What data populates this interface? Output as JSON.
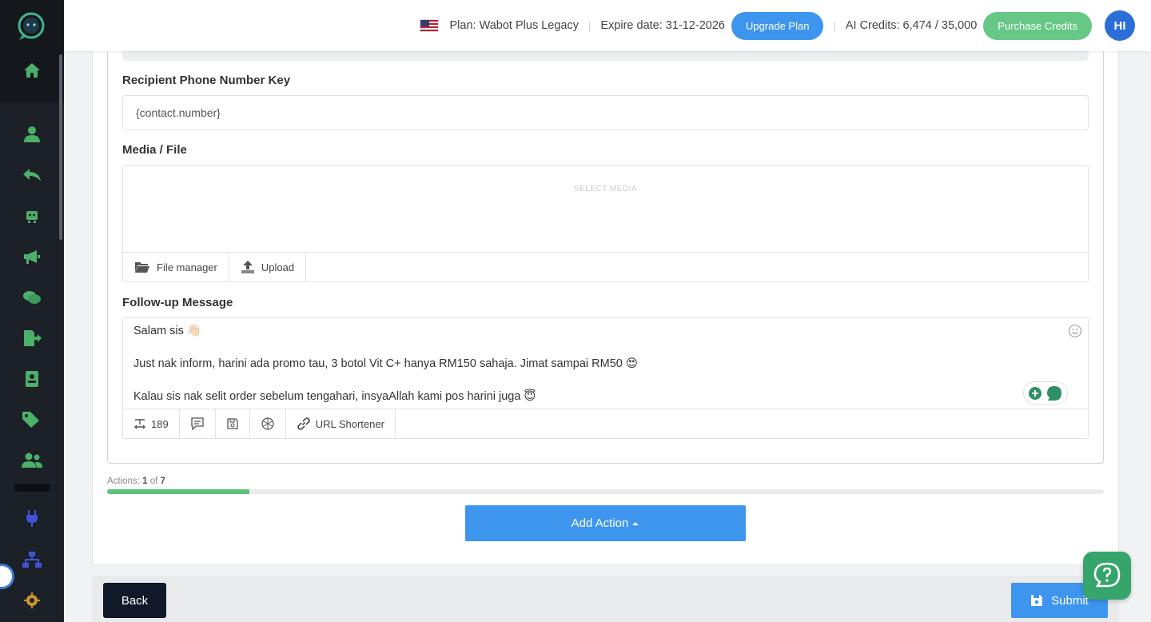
{
  "header": {
    "plan_label": "Plan: Wabot Plus Legacy",
    "expire_label": "Expire date: 31-12-2026",
    "upgrade_button": "Upgrade Plan",
    "credits_label": "AI Credits: 6,474 / 35,000",
    "purchase_button": "Purchase Credits",
    "avatar_initials": "HI",
    "separator": "|"
  },
  "form": {
    "recipient_label": "Recipient Phone Number Key",
    "recipient_value": "{contact.number}",
    "media_label": "Media / File",
    "media_placeholder": "SELECT MEDIA",
    "file_manager_button": "File manager",
    "upload_button": "Upload",
    "followup_label": "Follow-up Message",
    "message_lines": [
      "Salam sis 👋🏻",
      "",
      "Just nak inform, harini ada promo tau, 3 botol Vit C+ hanya RM150 sahaja. Jimat sampai RM50 😍",
      "",
      "Kalau sis nak selit order sebelum tengahari, insyaAllah kami pos harini juga 😇"
    ],
    "char_count": "189",
    "url_shortener_button": "URL Shortener"
  },
  "actions": {
    "label_prefix": "Actions:",
    "current": "1",
    "of_word": "of",
    "total": "7",
    "progress_fraction": 0.142857,
    "add_action_button": "Add Action"
  },
  "footer": {
    "back_button": "Back",
    "submit_button": "Submit"
  },
  "colors": {
    "primary": "#3d95ee",
    "success": "#66c786",
    "sidebar_bg": "#1c2127",
    "sidebar_icon": "#4caf6a",
    "help_button": "#36a56c"
  },
  "icons": {
    "sidebar": [
      "home-icon",
      "user-icon",
      "reply-icon",
      "robot-icon",
      "megaphone-icon",
      "chat-icon",
      "export-icon",
      "contact-card-icon",
      "tags-icon",
      "users-icon",
      "plug-icon",
      "sitemap-icon",
      "gear-icon"
    ],
    "toolbar": [
      "folder-icon",
      "upload-icon",
      "text-size-icon",
      "comment-icon",
      "save-icon",
      "openai-icon",
      "link-icon"
    ]
  }
}
